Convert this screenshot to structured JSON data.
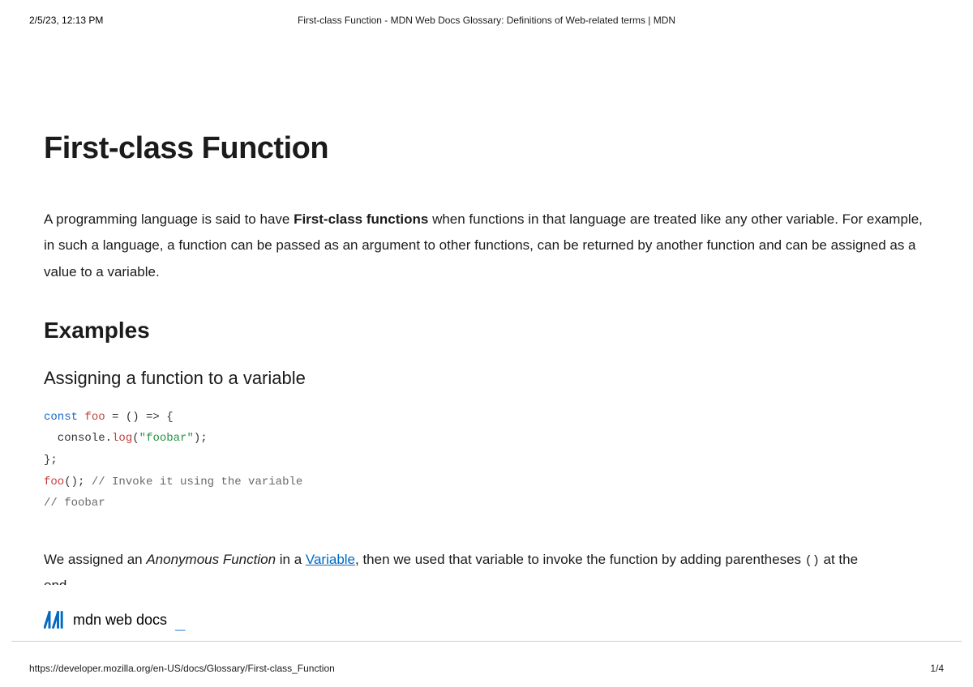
{
  "print_header": {
    "datetime": "2/5/23, 12:13 PM",
    "title": "First-class Function - MDN Web Docs Glossary: Definitions of Web-related terms | MDN"
  },
  "page": {
    "h1": "First-class Function",
    "intro_prefix": "A programming language is said to have ",
    "intro_bold": "First-class functions",
    "intro_suffix": " when functions in that language are treated like any other variable. For example, in such a language, a function can be passed as an argument to other functions, can be returned by another function and can be assigned as a value to a variable.",
    "h2_examples": "Examples",
    "h3_assigning": "Assigning a function to a variable",
    "code": {
      "l1_kw": "const",
      "l1_id": " foo",
      "l1_rest": " = () => {",
      "l2_pre": "  console.",
      "l2_method": "log",
      "l2_paren_open": "(",
      "l2_str": "\"foobar\"",
      "l2_paren_close": ");",
      "l3": "};",
      "l4_call": "foo",
      "l4_rest": "(); ",
      "l4_comment": "// Invoke it using the variable",
      "l5_comment": "// foobar"
    },
    "body2_prefix": "We assigned an ",
    "body2_em": "Anonymous Function",
    "body2_mid": " in a ",
    "body2_link": "Variable",
    "body2_after_link": ", then we used that variable to invoke the function by adding parentheses ",
    "body2_code": "()",
    "body2_suffix": " at the",
    "body2_cutoff": "end"
  },
  "brand": {
    "text": "mdn web docs",
    "cursor": "_"
  },
  "print_footer": {
    "url": "https://developer.mozilla.org/en-US/docs/Glossary/First-class_Function",
    "page": "1/4"
  }
}
